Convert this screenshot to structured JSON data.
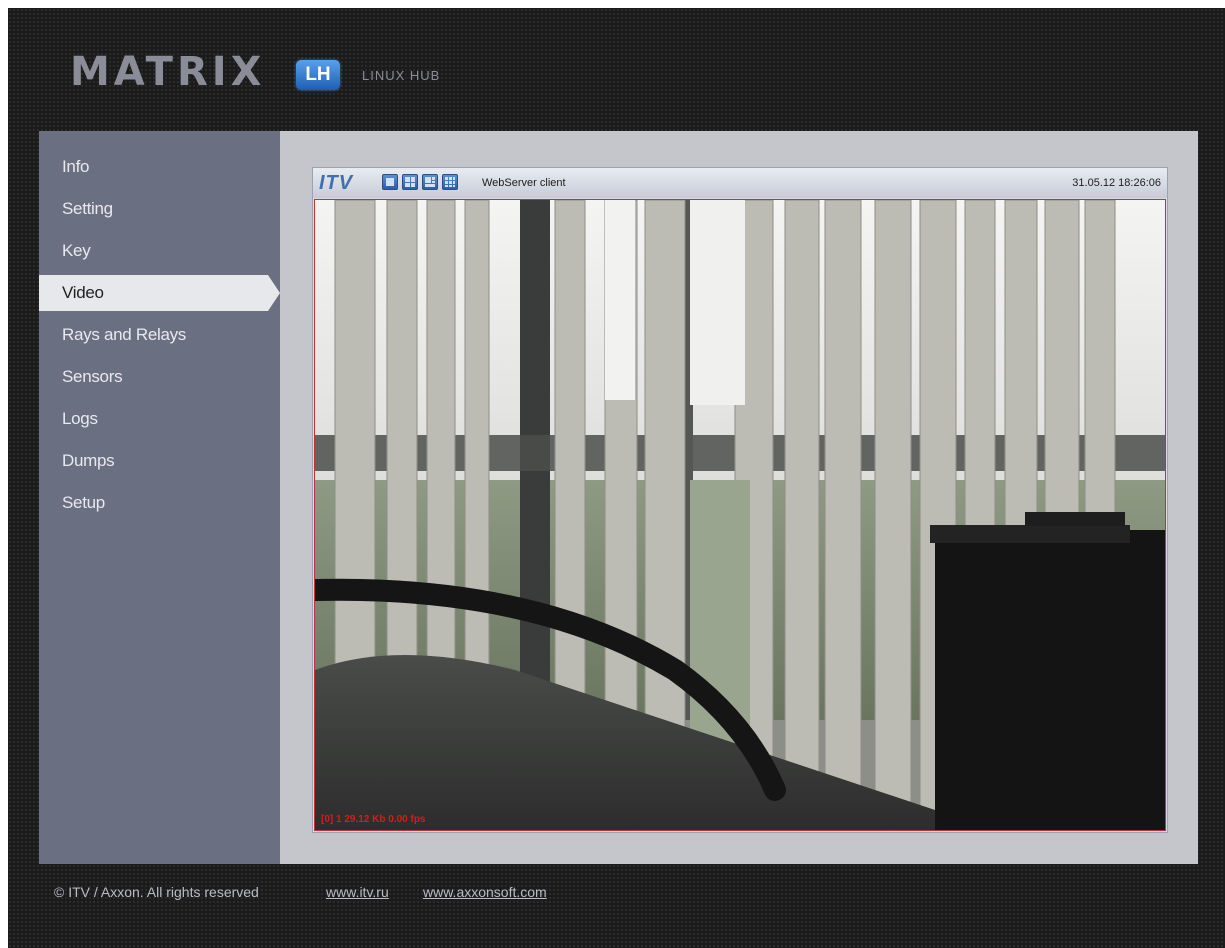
{
  "header": {
    "logo_word": "MATRIX",
    "logo_badge": "LH",
    "logo_subtitle": "LINUX HUB"
  },
  "nav": {
    "items": [
      {
        "label": "Info"
      },
      {
        "label": "Setting"
      },
      {
        "label": "Key"
      },
      {
        "label": "Video",
        "active": true
      },
      {
        "label": "Rays and Relays"
      },
      {
        "label": "Sensors"
      },
      {
        "label": "Logs"
      },
      {
        "label": "Dumps"
      },
      {
        "label": "Setup"
      }
    ]
  },
  "viewer": {
    "brand": "ITV",
    "title": "WebServer client",
    "datetime": "31.05.12 18:26:06",
    "layout_buttons": [
      "1x1",
      "2x2",
      "3x3",
      "4x4"
    ],
    "osd_text": "[0] 1  29.12 Kb  0.00 fps"
  },
  "footer": {
    "copyright": "© ITV / Axxon. All rights reserved",
    "link1": "www.itv.ru",
    "link2": "www.axxonsoft.com"
  },
  "colors": {
    "sidebar_bg": "#6b6f82",
    "active_item_bg": "#e7e8ec",
    "badge_blue": "#2c6fc5",
    "video_border": "#c2313d",
    "osd_red": "#d81b1b"
  }
}
